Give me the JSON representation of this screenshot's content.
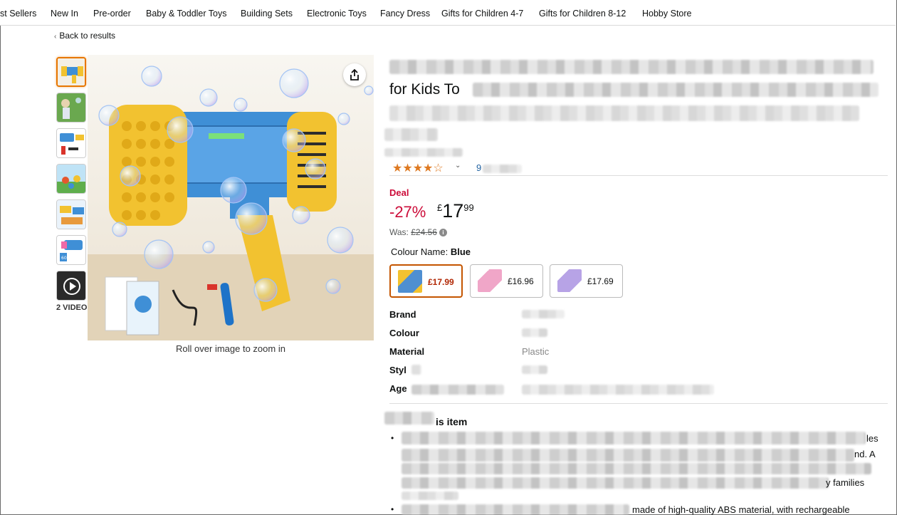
{
  "nav": {
    "items": [
      "st Sellers",
      "New In",
      "Pre-order",
      "Baby & Toddler Toys",
      "Building Sets",
      "Electronic Toys",
      "Fancy Dress",
      "Gifts for Children 4-7",
      "Gifts for Children 8-12",
      "Hobby Store"
    ]
  },
  "back_link": "Back to results",
  "gallery": {
    "videos_label": "2 VIDEO",
    "zoom_hint": "Roll over image to zoom in"
  },
  "product": {
    "title_line2": "for Kids To",
    "title_line3_tail": "'S Toys, Romantic Wedding, Kids Party Bag Fill",
    "title_frag_end": "ns",
    "title_frag_end2": "ers",
    "rating_stars": "4",
    "rating_count_prefix": "9",
    "deal_label": "Deal",
    "discount": "-27%",
    "price_symbol": "£",
    "price_whole": "17",
    "price_fraction": "99",
    "was_label": "Was:",
    "was_price": "£24.56",
    "colour_label": "Colour Name:",
    "colour_value": "Blue",
    "swatches": [
      {
        "price": "£17.99",
        "selected": true,
        "tint": "#4f8fd1"
      },
      {
        "price": "£16.96",
        "selected": false,
        "tint": "#f0a6c8"
      },
      {
        "price": "£17.69",
        "selected": false,
        "tint": "#b7a3e6"
      }
    ]
  },
  "specs": {
    "keys": [
      "Brand",
      "Colour",
      "Material",
      "Styl",
      "Age"
    ],
    "material_value": "Plastic"
  },
  "about": {
    "heading_tail": "is item",
    "bullet1_tail": "les",
    "bullet1_line2_tail": "nd. A",
    "bullet1_line4_tail": "y families",
    "bullet2_tail": "made of high-quality ABS material, with rechargeable"
  },
  "colors": {
    "deal": "#cc0c39",
    "link": "#2162a1",
    "star": "#de7921",
    "selected_border": "#e77600"
  }
}
